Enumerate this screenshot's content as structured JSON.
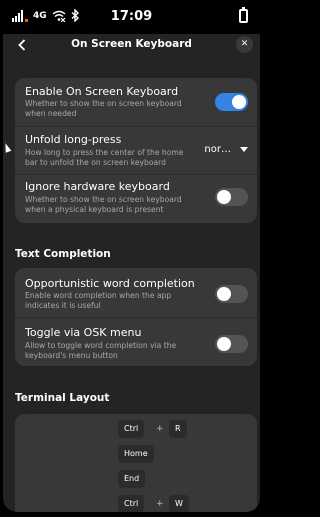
{
  "status_bar": {
    "network": "4G",
    "time": "17:09"
  },
  "header": {
    "title": "On Screen Keyboard"
  },
  "settings": [
    {
      "title": "Enable On Screen Keyboard",
      "subtitle": "Whether to show the on screen keyboard when needed",
      "control": "switch",
      "value": true
    },
    {
      "title": "Unfold long-press",
      "subtitle": "How long to press the center of the home bar to unfold the on screen keyboard",
      "control": "dropdown",
      "value": "nor…"
    },
    {
      "title": "Ignore hardware keyboard",
      "subtitle": "Whether to show the on screen keyboard when a physical keyboard is present",
      "control": "switch",
      "value": false
    }
  ],
  "text_completion": {
    "heading": "Text Completion",
    "items": [
      {
        "title": "Opportunistic word completion",
        "subtitle": "Enable word completion when the app indicates it is useful",
        "control": "switch",
        "value": false
      },
      {
        "title": "Toggle via OSK menu",
        "subtitle": "Allow to toggle word completion via the keyboard's menu button",
        "control": "switch",
        "value": false
      }
    ]
  },
  "terminal_layout": {
    "heading": "Terminal Layout",
    "shortcuts": [
      {
        "keys": [
          "Ctrl",
          "R"
        ]
      },
      {
        "keys": [
          "Home"
        ]
      },
      {
        "keys": [
          "End"
        ]
      },
      {
        "keys": [
          "Ctrl",
          "W"
        ]
      }
    ],
    "separator": "+"
  },
  "colors": {
    "accent": "#3584e4",
    "background": "#242424",
    "card": "#383838"
  }
}
